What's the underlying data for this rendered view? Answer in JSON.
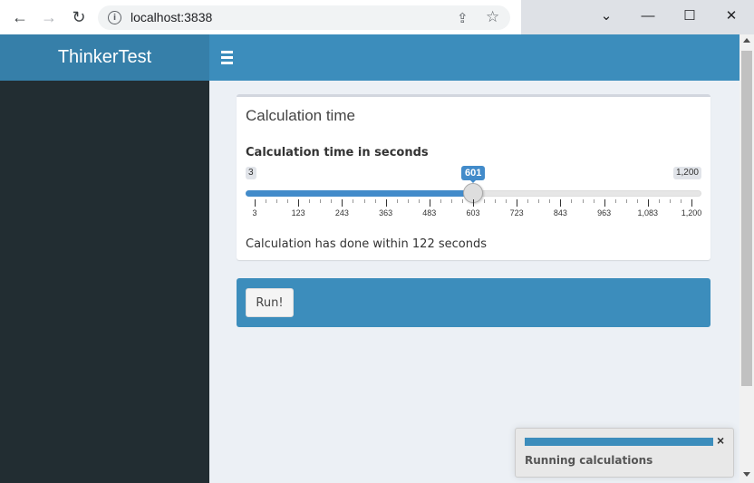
{
  "browser": {
    "url": "localhost:3838",
    "back_icon": "back-arrow-icon",
    "forward_icon": "forward-arrow-icon",
    "reload_icon": "reload-icon"
  },
  "app": {
    "title": "ThinkerTest"
  },
  "box": {
    "title": "Calculation time",
    "slider_label": "Calculation time in seconds",
    "slider": {
      "min_label": "3",
      "max_label": "1,200",
      "value_label": "601",
      "value": 601,
      "min": 3,
      "max": 1200,
      "ticks": [
        "3",
        "123",
        "243",
        "363",
        "483",
        "603",
        "723",
        "843",
        "963",
        "1,083",
        "1,200"
      ]
    },
    "result": "Calculation has done within 122 seconds"
  },
  "run": {
    "label": "Run!"
  },
  "notification": {
    "message": "Running calculations",
    "close": "×"
  }
}
